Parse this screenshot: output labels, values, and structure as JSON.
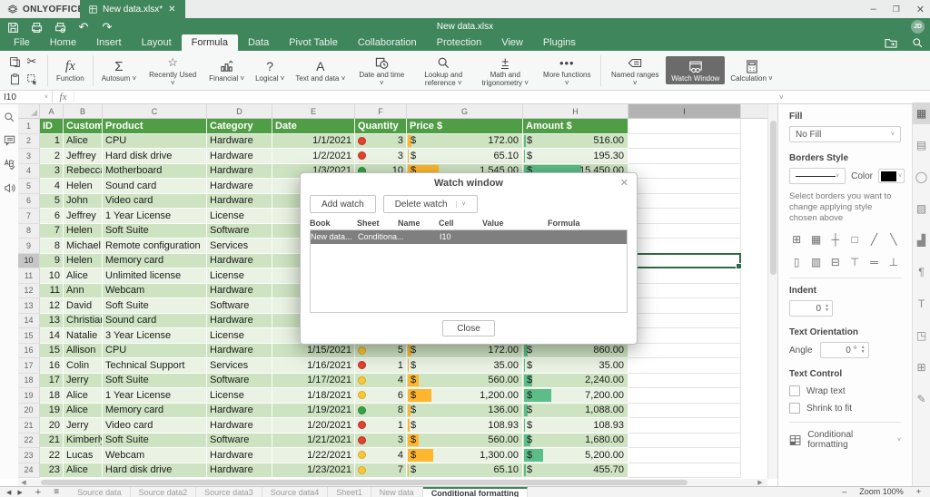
{
  "topbar": {
    "brand": "ONLYOFFICE",
    "doc_tab": "New data.xlsx*",
    "minimize": "–",
    "maximize": "❐",
    "close": "✕"
  },
  "toolbar": {
    "title": "New data.xlsx",
    "avatar": "JD",
    "quick_icons": [
      "save-icon",
      "print-icon",
      "quick-print-icon",
      "undo-icon",
      "redo-icon"
    ]
  },
  "ribbon": {
    "tabs": [
      {
        "label": "File",
        "active": false
      },
      {
        "label": "Home",
        "active": false
      },
      {
        "label": "Insert",
        "active": false
      },
      {
        "label": "Layout",
        "active": false
      },
      {
        "label": "Formula",
        "active": true
      },
      {
        "label": "Data",
        "active": false
      },
      {
        "label": "Pivot Table",
        "active": false
      },
      {
        "label": "Collaboration",
        "active": false
      },
      {
        "label": "Protection",
        "active": false
      },
      {
        "label": "View",
        "active": false
      },
      {
        "label": "Plugins",
        "active": false
      }
    ],
    "buttons": [
      {
        "label": "Function",
        "icon": "function-icon",
        "arrow": false,
        "active": false,
        "group_before": true
      },
      {
        "label": "Autosum",
        "icon": "autosum-icon",
        "arrow": true,
        "active": false,
        "group_before": true
      },
      {
        "label": "Recently Used",
        "icon": "star-icon",
        "arrow": true,
        "active": false
      },
      {
        "label": "Financial",
        "icon": "financial-icon",
        "arrow": true,
        "active": false
      },
      {
        "label": "Logical",
        "icon": "logical-icon",
        "arrow": true,
        "active": false
      },
      {
        "label": "Text and data",
        "icon": "text-icon",
        "arrow": true,
        "active": false
      },
      {
        "label": "Date and time",
        "icon": "datetime-icon",
        "arrow": true,
        "active": false
      },
      {
        "label": "Lookup and reference",
        "icon": "lookup-icon",
        "arrow": true,
        "active": false
      },
      {
        "label": "Math and trigonometry",
        "icon": "math-icon",
        "arrow": true,
        "active": false
      },
      {
        "label": "More functions",
        "icon": "more-icon",
        "arrow": true,
        "active": false
      },
      {
        "label": "Named ranges",
        "icon": "named-ranges-icon",
        "arrow": true,
        "active": false,
        "group_before": true
      },
      {
        "label": "Watch Window",
        "icon": "watch-window-icon",
        "arrow": false,
        "active": true
      },
      {
        "label": "Calculation",
        "icon": "calculation-icon",
        "arrow": true,
        "active": false
      }
    ]
  },
  "formula_bar": {
    "name_box": "I10",
    "fx": "fx",
    "value": ""
  },
  "sheet": {
    "columns": [
      "A",
      "B",
      "C",
      "D",
      "E",
      "F",
      "G",
      "H",
      "I"
    ],
    "selected_column": "I",
    "selected_row": 10,
    "selected_cell": "I10",
    "header_row": [
      "ID",
      "Customer",
      "Product",
      "Category",
      "Date",
      "Quantity",
      "Price $",
      "Amount $"
    ],
    "rows": [
      {
        "r": 2,
        "id": 1,
        "cu": "Alice",
        "pr": "CPU",
        "ca": "Hardware",
        "dt": "1/1/2021",
        "lt": "red",
        "qt": 3,
        "price": "172.00",
        "amount": "516.00",
        "pv": 172,
        "av": 516
      },
      {
        "r": 3,
        "id": 2,
        "cu": "Jeffrey",
        "pr": "Hard disk drive",
        "ca": "Hardware",
        "dt": "1/2/2021",
        "lt": "red",
        "qt": 3,
        "price": "65.10",
        "amount": "195.30",
        "pv": 65,
        "av": 195
      },
      {
        "r": 4,
        "id": 3,
        "cu": "Rebecca",
        "pr": "Motherboard",
        "ca": "Hardware",
        "dt": "1/3/2021",
        "lt": "green",
        "qt": 10,
        "price": "1,545.00",
        "amount": "15,450.00",
        "pv": 1545,
        "av": 15450
      },
      {
        "r": 5,
        "id": 4,
        "cu": "Helen",
        "pr": "Sound card",
        "ca": "Hardware",
        "dt": null,
        "lt": null,
        "qt": null,
        "price": null,
        "amount": null
      },
      {
        "r": 6,
        "id": 5,
        "cu": "John",
        "pr": "Video card",
        "ca": "Hardware",
        "dt": null,
        "lt": null,
        "qt": null,
        "price": null,
        "amount": null
      },
      {
        "r": 7,
        "id": 6,
        "cu": "Jeffrey",
        "pr": "1 Year License",
        "ca": "License",
        "dt": null,
        "lt": null,
        "qt": null,
        "price": null,
        "amount": null
      },
      {
        "r": 8,
        "id": 7,
        "cu": "Helen",
        "pr": "Soft Suite",
        "ca": "Software",
        "dt": null,
        "lt": null,
        "qt": null,
        "price": null,
        "amount": null
      },
      {
        "r": 9,
        "id": 8,
        "cu": "Michael",
        "pr": "Remote configuration",
        "ca": "Services",
        "dt": null,
        "lt": null,
        "qt": null,
        "price": null,
        "amount": null
      },
      {
        "r": 10,
        "id": 9,
        "cu": "Helen",
        "pr": "Memory card",
        "ca": "Hardware",
        "dt": null,
        "lt": null,
        "qt": null,
        "price": null,
        "amount": null
      },
      {
        "r": 11,
        "id": 10,
        "cu": "Alice",
        "pr": "Unlimited license",
        "ca": "License",
        "dt": null,
        "lt": null,
        "qt": null,
        "price": null,
        "amount": null
      },
      {
        "r": 12,
        "id": 11,
        "cu": "Ann",
        "pr": "Webcam",
        "ca": "Hardware",
        "dt": null,
        "lt": null,
        "qt": null,
        "price": null,
        "amount": null
      },
      {
        "r": 13,
        "id": 12,
        "cu": "David",
        "pr": "Soft Suite",
        "ca": "Software",
        "dt": null,
        "lt": null,
        "qt": null,
        "price": null,
        "amount": null
      },
      {
        "r": 14,
        "id": 13,
        "cu": "Christian",
        "pr": "Sound card",
        "ca": "Hardware",
        "dt": null,
        "lt": null,
        "qt": null,
        "price": null,
        "amount": null
      },
      {
        "r": 15,
        "id": 14,
        "cu": "Natalie",
        "pr": "3 Year License",
        "ca": "License",
        "dt": null,
        "lt": null,
        "qt": null,
        "price": null,
        "amount": null
      },
      {
        "r": 16,
        "id": 15,
        "cu": "Allison",
        "pr": "CPU",
        "ca": "Hardware",
        "dt": "1/15/2021",
        "lt": "yellow",
        "qt": 5,
        "price": "172.00",
        "amount": "860.00",
        "pv": 172,
        "av": 860
      },
      {
        "r": 17,
        "id": 16,
        "cu": "Colin",
        "pr": "Technical Support",
        "ca": "Services",
        "dt": "1/16/2021",
        "lt": "red",
        "qt": 1,
        "price": "35.00",
        "amount": "35.00",
        "pv": 35,
        "av": 35
      },
      {
        "r": 18,
        "id": 17,
        "cu": "Jerry",
        "pr": "Soft Suite",
        "ca": "Software",
        "dt": "1/17/2021",
        "lt": "yellow",
        "qt": 4,
        "price": "560.00",
        "amount": "2,240.00",
        "pv": 560,
        "av": 2240
      },
      {
        "r": 19,
        "id": 18,
        "cu": "Alice",
        "pr": "1 Year License",
        "ca": "License",
        "dt": "1/18/2021",
        "lt": "yellow",
        "qt": 6,
        "price": "1,200.00",
        "amount": "7,200.00",
        "pv": 1200,
        "av": 7200
      },
      {
        "r": 20,
        "id": 19,
        "cu": "Alice",
        "pr": "Memory card",
        "ca": "Hardware",
        "dt": "1/19/2021",
        "lt": "green",
        "qt": 8,
        "price": "136.00",
        "amount": "1,088.00",
        "pv": 136,
        "av": 1088
      },
      {
        "r": 21,
        "id": 20,
        "cu": "Jerry",
        "pr": "Video card",
        "ca": "Hardware",
        "dt": "1/20/2021",
        "lt": "red",
        "qt": 1,
        "price": "108.93",
        "amount": "108.93",
        "pv": 109,
        "av": 109
      },
      {
        "r": 22,
        "id": 21,
        "cu": "Kimberly",
        "pr": "Soft Suite",
        "ca": "Software",
        "dt": "1/21/2021",
        "lt": "red",
        "qt": 3,
        "price": "560.00",
        "amount": "1,680.00",
        "pv": 560,
        "av": 1680
      },
      {
        "r": 23,
        "id": 22,
        "cu": "Lucas",
        "pr": "Webcam",
        "ca": "Hardware",
        "dt": "1/22/2021",
        "lt": "yellow",
        "qt": 4,
        "price": "1,300.00",
        "amount": "5,200.00",
        "pv": 1300,
        "av": 5200
      },
      {
        "r": 24,
        "id": 23,
        "cu": "Alice",
        "pr": "Hard disk drive",
        "ca": "Hardware",
        "dt": "1/23/2021",
        "lt": "yellow",
        "qt": 7,
        "price": "65.10",
        "amount": "455.70",
        "pv": 65,
        "av": 456
      }
    ]
  },
  "dialog": {
    "title": "Watch window",
    "add_button": "Add watch",
    "delete_button": "Delete watch",
    "close_button": "Close",
    "close_icon": "✕",
    "columns": [
      "Book",
      "Sheet",
      "Name",
      "Cell",
      "Value",
      "Formula"
    ],
    "watch_rows": [
      {
        "book": "New data...",
        "sheet": "Conditiona...",
        "name": "",
        "cell": "I10",
        "value": "",
        "formula": ""
      }
    ]
  },
  "sidebar": {
    "fill_label": "Fill",
    "fill_value": "No Fill",
    "borders_label": "Borders Style",
    "color_label": "Color",
    "hint": "Select borders you want to change applying style chosen above",
    "indent_label": "Indent",
    "indent_value": "0",
    "orientation_label": "Text Orientation",
    "angle_label": "Angle",
    "angle_value": "0 °",
    "text_control_label": "Text Control",
    "wrap_label": "Wrap text",
    "shrink_label": "Shrink to fit",
    "cond_fmt_label": "Conditional formatting"
  },
  "statusbar": {
    "tabs": [
      "Source data",
      "Source data2",
      "Source data3",
      "Source data4",
      "Sheet1",
      "New data",
      "Conditional formatting"
    ],
    "active_tab": "Conditional formatting",
    "zoom_label": "Zoom 100%",
    "zoom_out": "–",
    "zoom_in": "+"
  },
  "colors": {
    "toolbar_green": "#40865c",
    "table_header_green": "#4f9d45",
    "row_even": "#cde3c1",
    "row_odd": "#e9f2e3",
    "bar_orange": "#fdb62d",
    "bar_green": "#5cbd88",
    "light_red": "#e0432f",
    "light_yellow": "#f6c73c",
    "light_green": "#3aa047"
  }
}
